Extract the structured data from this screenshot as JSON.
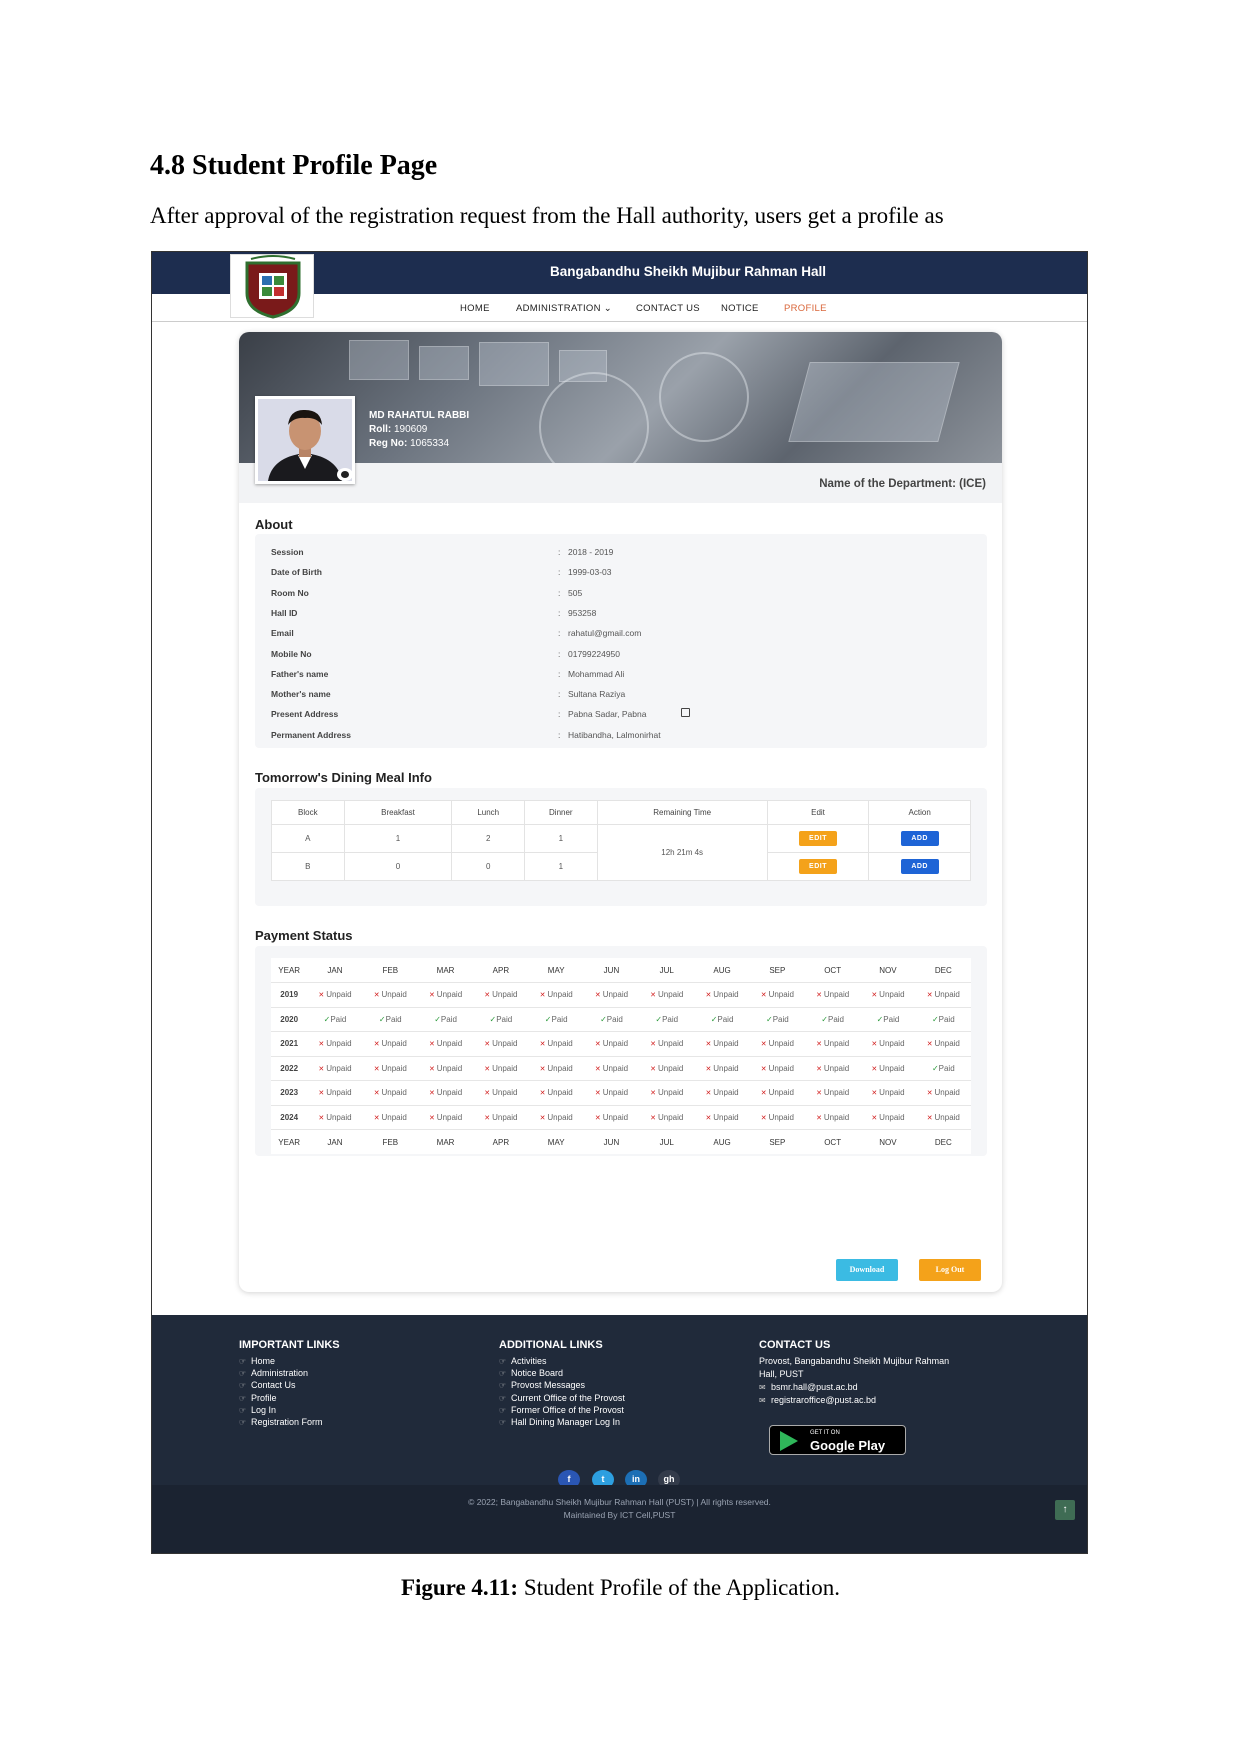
{
  "document": {
    "heading": "4.8 Student Profile Page",
    "paragraph": "After approval of the registration request from the Hall authority, users get a profile as",
    "caption_label": "Figure 4.11:",
    "caption_text": " Student Profile of the Application."
  },
  "site": {
    "title": "Bangabandhu Sheikh Mujibur Rahman Hall",
    "nav": [
      "HOME",
      "ADMINISTRATION",
      "CONTACT US",
      "NOTICE",
      "PROFILE"
    ],
    "active_nav": "PROFILE"
  },
  "profile": {
    "name": "MD RAHATUL RABBI",
    "roll_label": "Roll:",
    "roll": "190609",
    "reg_label": "Reg No:",
    "reg": "1065334",
    "department": "Name of the Department: (ICE)"
  },
  "about": {
    "title": "About",
    "rows": [
      {
        "label": "Session",
        "value": "2018 - 2019"
      },
      {
        "label": "Date of Birth",
        "value": "1999-03-03"
      },
      {
        "label": "Room No",
        "value": "505"
      },
      {
        "label": "Hall ID",
        "value": "953258"
      },
      {
        "label": "Email",
        "value": "rahatul@gmail.com"
      },
      {
        "label": "Mobile No",
        "value": "01799224950"
      },
      {
        "label": "Father's name",
        "value": "Mohammad Ali"
      },
      {
        "label": "Mother's name",
        "value": "Sultana Raziya"
      },
      {
        "label": "Present Address",
        "value": "Pabna Sadar, Pabna"
      },
      {
        "label": "Permanent Address",
        "value": "Hatibandha, Lalmonirhat"
      }
    ]
  },
  "meal": {
    "title": "Tomorrow's Dining Meal Info",
    "headers": [
      "Block",
      "Breakfast",
      "Lunch",
      "Dinner",
      "Remaining Time",
      "Edit",
      "Action"
    ],
    "rows": [
      {
        "block": "A",
        "breakfast": "1",
        "lunch": "2",
        "dinner": "1"
      },
      {
        "block": "B",
        "breakfast": "0",
        "lunch": "0",
        "dinner": "1"
      }
    ],
    "remaining_time": "12h 21m 4s",
    "edit_label": "EDIT",
    "add_label": "ADD"
  },
  "payment": {
    "title": "Payment Status",
    "year_header": "YEAR",
    "months": [
      "JAN",
      "FEB",
      "MAR",
      "APR",
      "MAY",
      "JUN",
      "JUL",
      "AUG",
      "SEP",
      "OCT",
      "NOV",
      "DEC"
    ],
    "paid_label": "Paid",
    "unpaid_label": "Unpaid",
    "rows": [
      {
        "year": "2019",
        "status": [
          0,
          0,
          0,
          0,
          0,
          0,
          0,
          0,
          0,
          0,
          0,
          0
        ]
      },
      {
        "year": "2020",
        "status": [
          1,
          1,
          1,
          1,
          1,
          1,
          1,
          1,
          1,
          1,
          1,
          1
        ]
      },
      {
        "year": "2021",
        "status": [
          0,
          0,
          0,
          0,
          0,
          0,
          0,
          0,
          0,
          0,
          0,
          0
        ]
      },
      {
        "year": "2022",
        "status": [
          0,
          0,
          0,
          0,
          0,
          0,
          0,
          0,
          0,
          0,
          0,
          1
        ]
      },
      {
        "year": "2023",
        "status": [
          0,
          0,
          0,
          0,
          0,
          0,
          0,
          0,
          0,
          0,
          0,
          0
        ]
      },
      {
        "year": "2024",
        "status": [
          0,
          0,
          0,
          0,
          0,
          0,
          0,
          0,
          0,
          0,
          0,
          0
        ]
      }
    ]
  },
  "actions": {
    "download": "Download",
    "logout": "Log Out"
  },
  "footer": {
    "important_title": "IMPORTANT LINKS",
    "important_links": [
      "Home",
      "Administration",
      "Contact Us",
      "Profile",
      "Log In",
      "Registration Form"
    ],
    "additional_title": "ADDITIONAL LINKS",
    "additional_links": [
      "Activities",
      "Notice Board",
      "Provost Messages",
      "Current Office of the Provost",
      "Former Office of the Provost",
      "Hall Dining Manager Log In"
    ],
    "contact_title": "CONTACT US",
    "contact_address_1": "Provost, Bangabandhu Sheikh Mujibur Rahman",
    "contact_address_2": "Hall, PUST",
    "contact_email_1": "bsmr.hall@pust.ac.bd",
    "contact_email_2": "registraroffice@pust.ac.bd",
    "gplay_small": "GET IT ON",
    "gplay_big": "Google Play",
    "social": [
      "f",
      "t",
      "in",
      "gh"
    ],
    "copyright": "© 2022; Bangabandhu Sheikh Mujibur Rahman Hall (PUST) | All rights reserved.",
    "maintained": "Maintained By ICT Cell,PUST",
    "colors": {
      "facebook": "#2a56b4",
      "twitter": "#2d9fe0",
      "linkedin": "#1c6fb5",
      "github": "#333b4a"
    }
  }
}
